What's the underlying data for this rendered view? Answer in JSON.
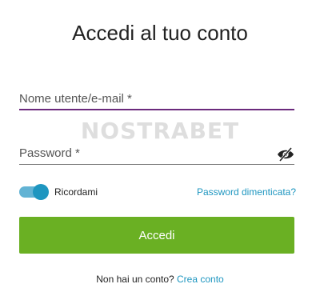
{
  "login": {
    "title": "Accedi al tuo conto",
    "username_placeholder": "Nome utente/e-mail *",
    "password_placeholder": "Password *",
    "watermark": "NOSTRABET",
    "remember_label": "Ricordami",
    "remember_checked": true,
    "forgot_link": "Password dimenticata?",
    "submit_label": "Accedi",
    "signup_prompt": "Non hai un conto?",
    "signup_link": "Crea conto"
  },
  "icons": {
    "password_toggle": "eye-slash-icon"
  },
  "colors": {
    "primary_button": "#6ab023",
    "link": "#1e96c0",
    "active_field_underline": "#6b2a7d",
    "toggle_on": "#1e96c0"
  }
}
